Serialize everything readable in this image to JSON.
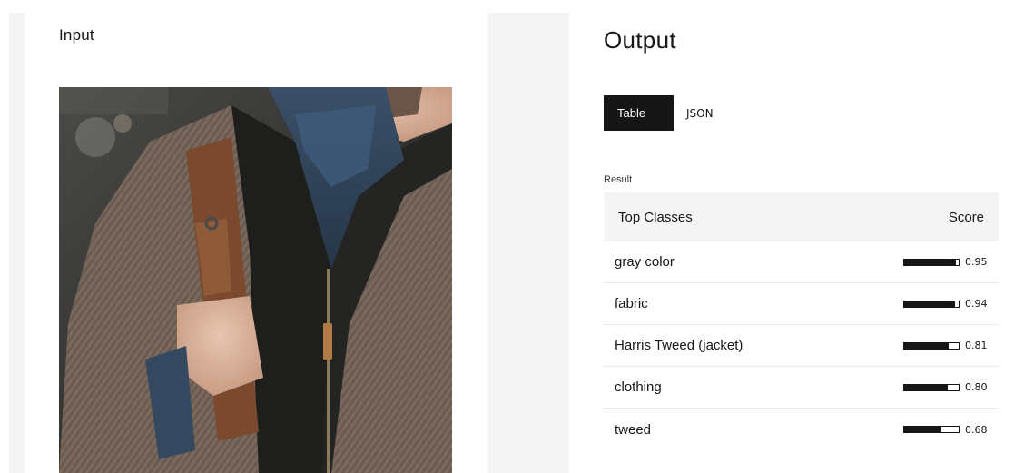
{
  "input": {
    "title": "Input",
    "image_alt": "man in tweed jacket with leather backpack strap"
  },
  "output": {
    "title": "Output",
    "tabs": [
      {
        "label": "Table",
        "active": true
      },
      {
        "label": "JSON",
        "active": false
      }
    ],
    "result_label": "Result",
    "table": {
      "headers": [
        "Top Classes",
        "Score"
      ],
      "rows": [
        {
          "label": "gray color",
          "score": 0.95,
          "score_text": "0.95"
        },
        {
          "label": "fabric",
          "score": 0.94,
          "score_text": "0.94"
        },
        {
          "label": "Harris Tweed (jacket)",
          "score": 0.81,
          "score_text": "0.81"
        },
        {
          "label": "clothing",
          "score": 0.8,
          "score_text": "0.80"
        },
        {
          "label": "tweed",
          "score": 0.68,
          "score_text": "0.68"
        }
      ]
    }
  },
  "colors": {
    "accent": "#161616",
    "panel_bg": "#f4f4f4"
  }
}
